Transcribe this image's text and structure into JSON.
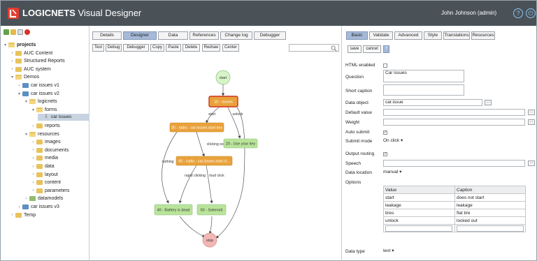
{
  "app": {
    "title_brand": "LOGICNETS",
    "title_rest": " Visual Designer",
    "user": "John Johnson (admin)",
    "help_glyph": "?",
    "power_glyph": "⏻"
  },
  "tree": {
    "items": [
      {
        "label": "projects",
        "level": 0,
        "icon": "folder",
        "expanded": true,
        "bold": true
      },
      {
        "label": "AUC Content",
        "level": 1,
        "icon": "folder",
        "expanded": false
      },
      {
        "label": "Structured Reports",
        "level": 1,
        "icon": "folder",
        "expanded": false
      },
      {
        "label": "AUC system",
        "level": 1,
        "icon": "folder",
        "expanded": false
      },
      {
        "label": "Demos",
        "level": 1,
        "icon": "folder",
        "expanded": true
      },
      {
        "label": "car issues v1",
        "level": 2,
        "icon": "folder-blue",
        "expanded": false
      },
      {
        "label": "car issues v2",
        "level": 2,
        "icon": "folder-blue",
        "expanded": true
      },
      {
        "label": "logicnets",
        "level": 3,
        "icon": "folder",
        "expanded": true
      },
      {
        "label": "forms",
        "level": 4,
        "icon": "folder",
        "expanded": true
      },
      {
        "label": "car issues",
        "level": 5,
        "icon": "node",
        "selected": true
      },
      {
        "label": "reports",
        "level": 4,
        "icon": "folder",
        "expanded": false
      },
      {
        "label": "resources",
        "level": 3,
        "icon": "folder",
        "expanded": true
      },
      {
        "label": "images",
        "level": 4,
        "icon": "folder",
        "expanded": false
      },
      {
        "label": "documents",
        "level": 4,
        "icon": "folder",
        "expanded": false
      },
      {
        "label": "media",
        "level": 4,
        "icon": "folder",
        "expanded": false
      },
      {
        "label": "data",
        "level": 4,
        "icon": "folder",
        "expanded": false
      },
      {
        "label": "layout",
        "level": 4,
        "icon": "folder",
        "expanded": false
      },
      {
        "label": "content",
        "level": 4,
        "icon": "folder",
        "expanded": false
      },
      {
        "label": "parameters",
        "level": 4,
        "icon": "folder",
        "expanded": false
      },
      {
        "label": "datamodels",
        "level": 3,
        "icon": "folder-green",
        "expanded": false
      },
      {
        "label": "car issues v3",
        "level": 2,
        "icon": "folder-blue",
        "expanded": false
      },
      {
        "label": "Temp",
        "level": 1,
        "icon": "folder",
        "expanded": false
      }
    ]
  },
  "designer": {
    "tabs": [
      "Details",
      "Designer",
      "Data",
      "References",
      "Change log",
      "Debugger"
    ],
    "active_tab": "Designer",
    "toolbar": [
      "Test",
      "Debug",
      "Debugger",
      "Copy",
      "Paste",
      "Delete",
      "Redraw",
      "Center"
    ],
    "search_value": ""
  },
  "flow": {
    "nodes": {
      "start": "start",
      "n10": "10 - Issues",
      "n30": "30 - radio - car.issues.start.key",
      "n20": "20 - Use your key",
      "n60": "60 - radio - car.issues.start.cl...",
      "n40": "40 - Battery is dead",
      "n50": "50 - Solenoid",
      "stop": "stop"
    },
    "edges": {
      "start": "start",
      "unlock": "unlock",
      "clicking_sound": "clicking sound",
      "nothing": "nothing",
      "rapid_clicking": "rapid clicking",
      "loud_click": "loud click"
    }
  },
  "props": {
    "tabs": [
      "Basic",
      "Validate",
      "Advanced",
      "Style",
      "Translations",
      "Resources"
    ],
    "active_tab": "Basic",
    "actions": {
      "save": "save",
      "cancel": "cancel",
      "help": "?"
    },
    "fields": {
      "html_enabled_label": "HTML enabled",
      "html_enabled": false,
      "question_label": "Question",
      "question": "Car issues",
      "short_caption_label": "Short caption",
      "short_caption": "",
      "data_object_label": "Data object",
      "data_object": "car.issue",
      "default_value_label": "Default value",
      "default_value": "",
      "weight_label": "Weight",
      "weight": "",
      "auto_submit_label": "Auto submit",
      "auto_submit": true,
      "submit_mode_label": "Submit mode",
      "submit_mode": "On click",
      "output_routing_label": "Output routing",
      "output_routing": true,
      "speech_label": "Speech",
      "speech": "",
      "data_location_label": "Data location",
      "data_location": "manual",
      "options_label": "Options",
      "data_type_label": "Data type",
      "data_type": "text"
    },
    "options_table": {
      "headers": [
        "Value",
        "Caption"
      ],
      "rows": [
        [
          "start",
          "does not start"
        ],
        [
          "leakage",
          "leakage"
        ],
        [
          "tires",
          "flat tire"
        ],
        [
          "unlock",
          "locked out"
        ]
      ]
    },
    "dots": "..."
  },
  "colors": {
    "topbar": "#4a5258",
    "active_tab": "#a6bad8",
    "node_orange": "#e9a23b",
    "node_green": "#b9e49a",
    "node_red": "#f0b7b4",
    "selected_border": "#d0301e"
  }
}
